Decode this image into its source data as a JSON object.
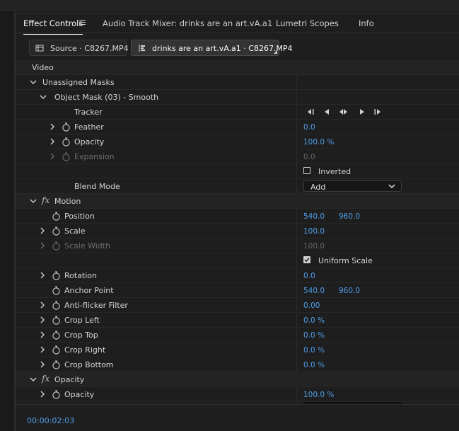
{
  "tabs": [
    {
      "label": "Effect Controls"
    },
    {
      "label": "Audio Track Mixer: drinks are an art.vA.a1"
    },
    {
      "label": "Lumetri Scopes"
    },
    {
      "label": "Info"
    }
  ],
  "source_bar": {
    "source_label": "Source · C8267.MP4",
    "sequence_label": "drinks are an art.vA.a1 · C8267.MP4"
  },
  "rows": {
    "video": "Video",
    "unassigned_masks": "Unassigned Masks",
    "object_mask": "Object Mask (03) - Smooth",
    "tracker": "Tracker",
    "feather": {
      "label": "Feather",
      "value": "0.0"
    },
    "mask_opacity": {
      "label": "Opacity",
      "value": "100.0 %"
    },
    "expansion": {
      "label": "Expansion",
      "value": "0.0"
    },
    "inverted": {
      "label": "Inverted",
      "checked": false
    },
    "blend_mode": {
      "label": "Blend Mode",
      "value": "Add"
    },
    "motion": "Motion",
    "fx_symbol": "fx",
    "position": {
      "label": "Position",
      "x": "540.0",
      "y": "960.0"
    },
    "scale": {
      "label": "Scale",
      "value": "100.0"
    },
    "scale_width": {
      "label": "Scale Width",
      "value": "100.0"
    },
    "uniform_scale": {
      "label": "Uniform Scale",
      "checked": true
    },
    "rotation": {
      "label": "Rotation",
      "value": "0.0"
    },
    "anchor_point": {
      "label": "Anchor Point",
      "x": "540.0",
      "y": "960.0"
    },
    "anti_flicker": {
      "label": "Anti-flicker Filter",
      "value": "0.00"
    },
    "crop_left": {
      "label": "Crop Left",
      "value": "0.0 %"
    },
    "crop_top": {
      "label": "Crop Top",
      "value": "0.0 %"
    },
    "crop_right": {
      "label": "Crop Right",
      "value": "0.0 %"
    },
    "crop_bottom": {
      "label": "Crop Bottom",
      "value": "0.0 %"
    },
    "opacity_section": "Opacity",
    "opacity": {
      "label": "Opacity",
      "value": "100.0 %"
    }
  },
  "timecode": "00:00:02:03",
  "colors": {
    "value_blue": "#4f9ee8",
    "panel_bg": "#1e1e1e",
    "section_bg": "#232323"
  },
  "icons": {
    "stopwatch": "stopwatch-icon",
    "chevron_right": "chevron-right-icon",
    "chevron_down": "chevron-down-icon",
    "hamburger": "menu-icon"
  }
}
